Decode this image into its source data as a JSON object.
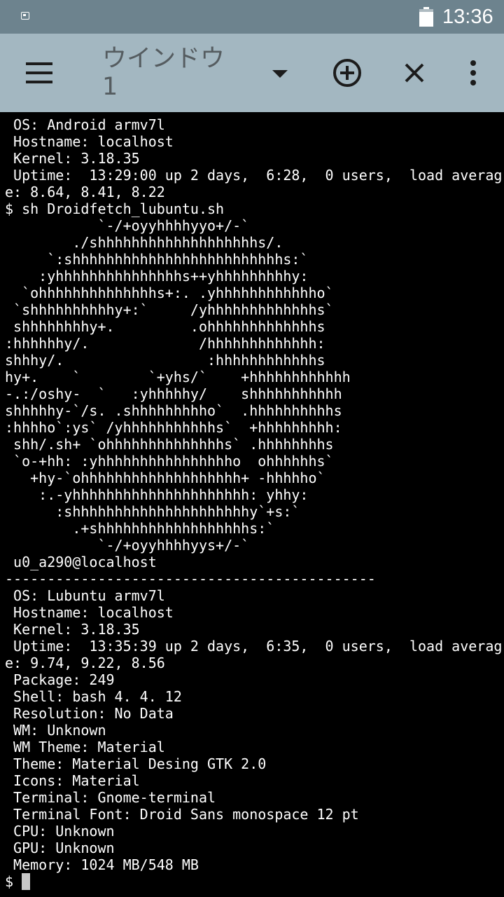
{
  "status_bar": {
    "time": "13:36",
    "battery_level": 0.85,
    "notification_icon": "app-notification-icon"
  },
  "toolbar": {
    "window_title": "ウインドウ 1",
    "menu_icon": "hamburger-menu-icon",
    "dropdown_icon": "caret-down-icon",
    "add_icon": "add-circle-icon",
    "close_icon": "close-icon",
    "more_icon": "more-vert-icon"
  },
  "colors": {
    "status_bar": "#6d838e",
    "toolbar": "#a3b7c1",
    "terminal_bg": "#000000",
    "terminal_text": "#ffffff"
  },
  "terminal": {
    "prompt": "$",
    "lines": [
      " OS: Android armv7l",
      " Hostname: localhost",
      " Kernel: 3.18.35",
      " Uptime:  13:29:00 up 2 days,  6:28,  0 users,  load averag",
      "e: 8.64, 8.41, 8.22",
      "$ sh Droidfetch_lubuntu.sh",
      "           `-/+oyyhhhhyyo+/-`",
      "        ./shhhhhhhhhhhhhhhhhhhs/.",
      "     `:shhhhhhhhhhhhhhhhhhhhhhhhhs:`",
      "    :yhhhhhhhhhhhhhhhs++yhhhhhhhhhy:",
      "  `ohhhhhhhhhhhhhhs+:. .yhhhhhhhhhhhho`",
      " `shhhhhhhhhhy+:`     /yhhhhhhhhhhhhhs`",
      " shhhhhhhhy+.         .ohhhhhhhhhhhhhs",
      ":hhhhhhy/.             /hhhhhhhhhhhhh:",
      "shhhy/.                 :hhhhhhhhhhhhs",
      "hy+.    `        `+yhs/`    +hhhhhhhhhhhh",
      "-.:/oshy-  `   :yhhhhhy/    shhhhhhhhhhh",
      "shhhhhy-`/s. .shhhhhhhhho`  .hhhhhhhhhhs",
      ":hhhho`:ys` /yhhhhhhhhhhhs`  +hhhhhhhhh:",
      " shh/.sh+ `ohhhhhhhhhhhhhhs` .hhhhhhhhs",
      " `o-+hh: :yhhhhhhhhhhhhhhhho  ohhhhhhs`",
      "   +hy-`ohhhhhhhhhhhhhhhhhhh+ -hhhhho`",
      "    :.-yhhhhhhhhhhhhhhhhhhhhh: yhhy:",
      "      :shhhhhhhhhhhhhhhhhhhhhy`+s:`",
      "        .+shhhhhhhhhhhhhhhhhhs:`",
      "           `-/+oyyhhhhyys+/-`",
      " u0_a290@localhost",
      "--------------------------------------------",
      " OS: Lubuntu armv7l",
      " Hostname: localhost",
      " Kernel: 3.18.35",
      " Uptime:  13:35:39 up 2 days,  6:35,  0 users,  load averag",
      "e: 9.74, 9.22, 8.56",
      " Package: 249",
      " Shell: bash 4. 4. 12",
      " Resolution: No Data",
      " WM: Unknown",
      " WM Theme: Material",
      " Theme: Material Desing GTK 2.0",
      " Icons: Material",
      " Terminal: Gnome-terminal",
      " Terminal Font: Droid Sans monospace 12 pt",
      " CPU: Unknown",
      " GPU: Unknown",
      " Memory: 1024 MB/548 MB"
    ]
  }
}
